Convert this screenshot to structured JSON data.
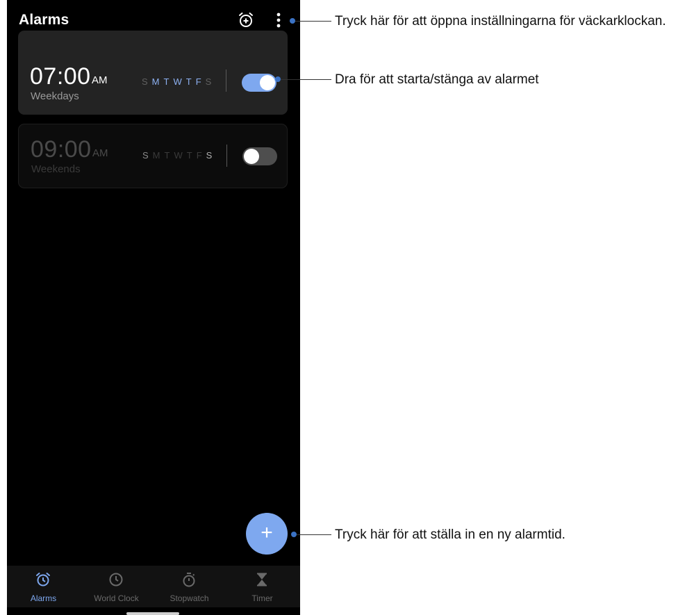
{
  "app": {
    "title": "Alarms"
  },
  "alarms": [
    {
      "time": "07:00",
      "ampm": "AM",
      "label": "Weekdays",
      "enabled": true,
      "days": [
        {
          "letter": "S",
          "active": false
        },
        {
          "letter": "M",
          "active": true
        },
        {
          "letter": "T",
          "active": true
        },
        {
          "letter": "W",
          "active": true
        },
        {
          "letter": "T",
          "active": true
        },
        {
          "letter": "F",
          "active": true
        },
        {
          "letter": "S",
          "active": false
        }
      ]
    },
    {
      "time": "09:00",
      "ampm": "AM",
      "label": "Weekends",
      "enabled": false,
      "days": [
        {
          "letter": "S",
          "active": true
        },
        {
          "letter": "M",
          "active": false
        },
        {
          "letter": "T",
          "active": false
        },
        {
          "letter": "W",
          "active": false
        },
        {
          "letter": "T",
          "active": false
        },
        {
          "letter": "F",
          "active": false
        },
        {
          "letter": "S",
          "active": true
        }
      ]
    }
  ],
  "fab": {
    "symbol": "+"
  },
  "bottom_nav": [
    {
      "label": "Alarms",
      "icon": "alarm-clock-icon",
      "active": true
    },
    {
      "label": "World Clock",
      "icon": "clock-icon",
      "active": false
    },
    {
      "label": "Stopwatch",
      "icon": "stopwatch-icon",
      "active": false
    },
    {
      "label": "Timer",
      "icon": "hourglass-icon",
      "active": false
    }
  ],
  "callouts": {
    "settings": "Tryck här för att öppna inställningarna för väckarklockan.",
    "toggle": "Dra för att starta/stänga av alarmet",
    "new_alarm": "Tryck här för att ställa in en ny alarmtid."
  },
  "colors": {
    "accent": "#7ea8ef",
    "callout_dot": "#3b72c4",
    "background": "#000000"
  }
}
